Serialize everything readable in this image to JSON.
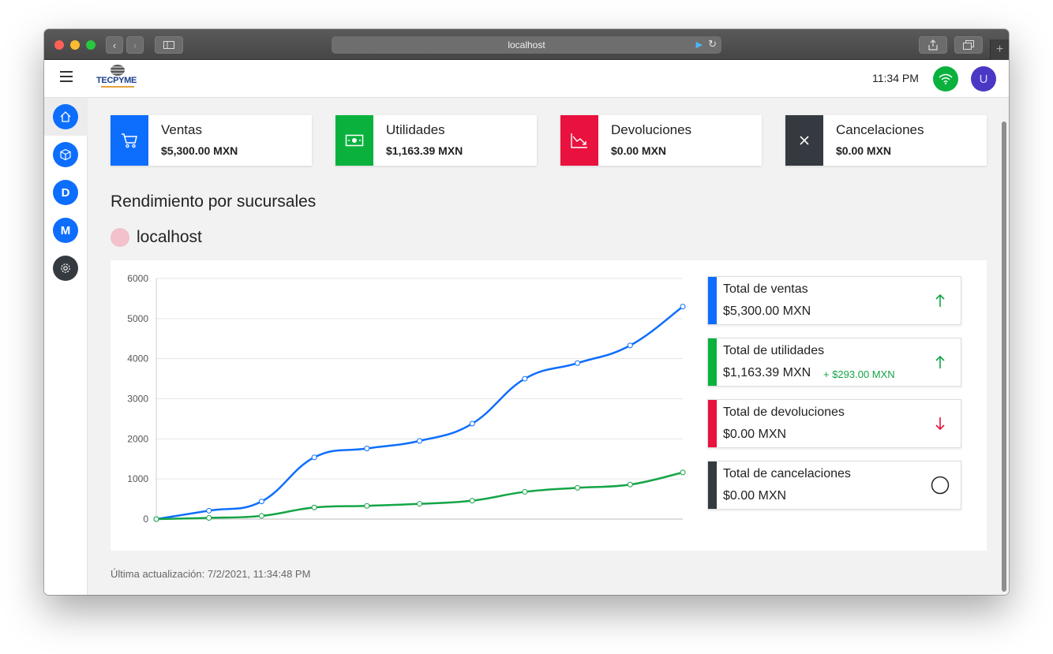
{
  "browser": {
    "url": "localhost"
  },
  "appbar": {
    "logo_text": "TECPYME",
    "time": "11:34 PM",
    "avatar_initial": "U"
  },
  "sidebar": {
    "items": [
      {
        "icon": "home-icon"
      },
      {
        "icon": "box-icon"
      },
      {
        "label": "D"
      },
      {
        "label": "M"
      },
      {
        "icon": "gear-icon"
      }
    ]
  },
  "stats": [
    {
      "label": "Ventas",
      "value": "$5,300.00 MXN",
      "color": "#0d6efd",
      "icon": "cart-icon"
    },
    {
      "label": "Utilidades",
      "value": "$1,163.39 MXN",
      "color": "#0ab23d",
      "icon": "cash-icon"
    },
    {
      "label": "Devoluciones",
      "value": "$0.00 MXN",
      "color": "#e9113e",
      "icon": "chart-down-icon"
    },
    {
      "label": "Cancelaciones",
      "value": "$0.00 MXN",
      "color": "#343a40",
      "icon": "x-icon"
    }
  ],
  "section": {
    "title": "Rendimiento por sucursales",
    "branch_name": "localhost",
    "branch_color": "#f2c1cc"
  },
  "totals": [
    {
      "label": "Total de ventas",
      "value": "$5,300.00 MXN",
      "color": "#0d6efd",
      "indicator": "arrow-up-icon",
      "delta": ""
    },
    {
      "label": "Total de utilidades",
      "value": "$1,163.39 MXN",
      "color": "#0ab23d",
      "indicator": "arrow-up-icon",
      "delta": "+ $293.00 MXN"
    },
    {
      "label": "Total de devoluciones",
      "value": "$0.00 MXN",
      "color": "#e9113e",
      "indicator": "arrow-down-icon",
      "delta": ""
    },
    {
      "label": "Total de cancelaciones",
      "value": "$0.00 MXN",
      "color": "#343a40",
      "indicator": "circle-icon",
      "delta": ""
    }
  ],
  "footer": {
    "last_update": "Última actualización: 7/2/2021, 11:34:48 PM"
  },
  "chart_data": {
    "type": "line",
    "x": [
      0,
      1,
      2,
      3,
      4,
      5,
      6,
      7,
      8,
      9,
      10
    ],
    "ylim": [
      0,
      6000
    ],
    "yticks": [
      "0",
      "1000",
      "2000",
      "3000",
      "4000",
      "5000",
      "6000"
    ],
    "grid": true,
    "series": [
      {
        "color": "#0d6efd",
        "values": [
          0,
          210,
          440,
          1540,
          1760,
          1950,
          2380,
          3500,
          3890,
          4330,
          5300
        ]
      },
      {
        "color": "#14a546",
        "values": [
          0,
          30,
          80,
          290,
          330,
          380,
          460,
          680,
          780,
          860,
          1163.39
        ]
      }
    ]
  }
}
